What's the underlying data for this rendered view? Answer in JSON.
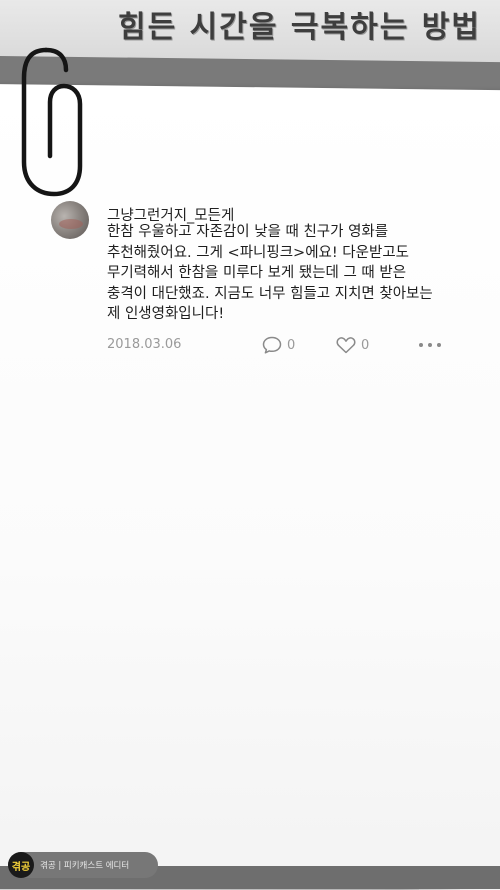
{
  "header": {
    "title": "힘든 시간을 극복하는 방법"
  },
  "post": {
    "username": "그냥그런거지_모든게",
    "body": "한참 우울하고 자존감이 낮을 때 친구가 영화를\n추천해줬어요. 그게 <파니핑크>에요! 다운받고도\n무기력해서 한참을 미루다 보게 됐는데 그 때 받은\n충격이 대단했죠. 지금도 너무 힘들고 지치면 찾아보는\n제 인생영화입니다!",
    "date": "2018.03.06",
    "comment_count": "0",
    "like_count": "0"
  },
  "footer": {
    "logo_text": "겪공",
    "label": "겪공 | 피키캐스트 에디터"
  },
  "icons": {
    "comment": "speech-bubble-icon",
    "like": "heart-icon",
    "more": "more-dots-icon",
    "clip": "paperclip-icon"
  }
}
